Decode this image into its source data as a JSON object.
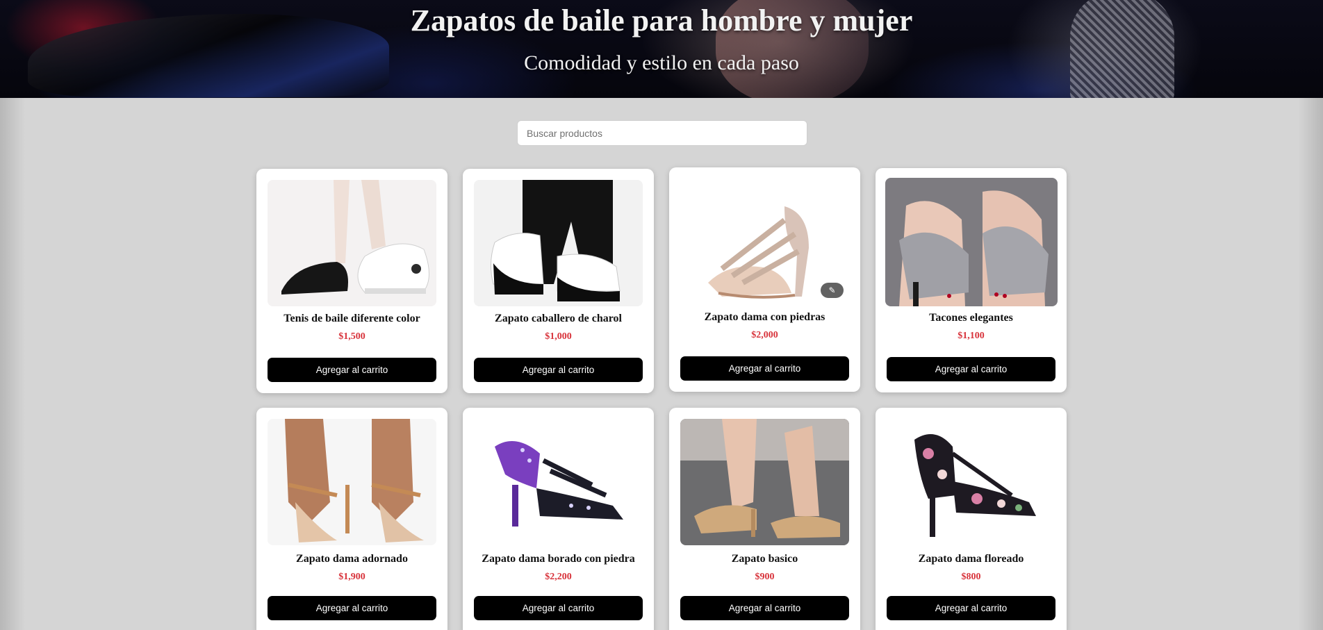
{
  "hero": {
    "title": "Zapatos de baile para hombre y mujer",
    "subtitle": "Comodidad y estilo en cada paso"
  },
  "search": {
    "placeholder": "Buscar productos",
    "value": ""
  },
  "colors": {
    "price": "#d8333b",
    "button_bg": "#000000",
    "page_bg": "#d5d5d5"
  },
  "products": [
    {
      "name": "Tenis de baile diferente color",
      "price": "$1,500",
      "button_label": "Agregar al carrito"
    },
    {
      "name": "Zapato caballero de charol",
      "price": "$1,000",
      "button_label": "Agregar al carrito"
    },
    {
      "name": "Zapato dama con piedras",
      "price": "$2,000",
      "button_label": "Agregar al carrito",
      "image_badge_icon": "magic-wand-icon"
    },
    {
      "name": "Tacones elegantes",
      "price": "$1,100",
      "button_label": "Agregar al carrito"
    },
    {
      "name": "Zapato dama adornado",
      "price": "$1,900",
      "button_label": "Agregar al carrito"
    },
    {
      "name": "Zapato dama borado con piedra",
      "price": "$2,200",
      "button_label": "Agregar al carrito"
    },
    {
      "name": "Zapato basico",
      "price": "$900",
      "button_label": "Agregar al carrito"
    },
    {
      "name": "Zapato dama floreado",
      "price": "$800",
      "button_label": "Agregar al carrito"
    }
  ]
}
